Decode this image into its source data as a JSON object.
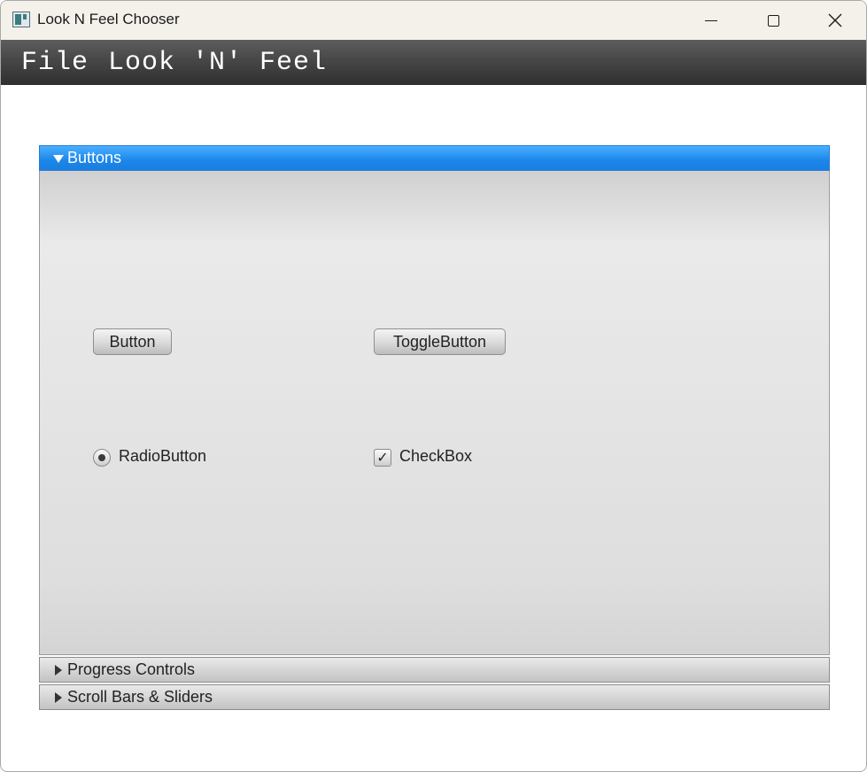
{
  "window": {
    "title": "Look N Feel Chooser",
    "controls": [
      "minimize-icon",
      "maximize-icon",
      "close-icon"
    ]
  },
  "menubar": {
    "items": [
      {
        "label": "File"
      },
      {
        "label": "Look 'N' Feel"
      }
    ]
  },
  "accordion": {
    "panes": [
      {
        "title": "Buttons",
        "expanded": true,
        "controls": {
          "button_label": "Button",
          "toggle_label": "ToggleButton",
          "radio_label": "RadioButton",
          "radio_selected": true,
          "checkbox_label": "CheckBox",
          "checkbox_checked": true,
          "check_glyph": "✓"
        }
      },
      {
        "title": "Progress Controls",
        "expanded": false
      },
      {
        "title": "Scroll Bars & Sliders",
        "expanded": false
      }
    ],
    "accent_color": "#1c86ea"
  }
}
